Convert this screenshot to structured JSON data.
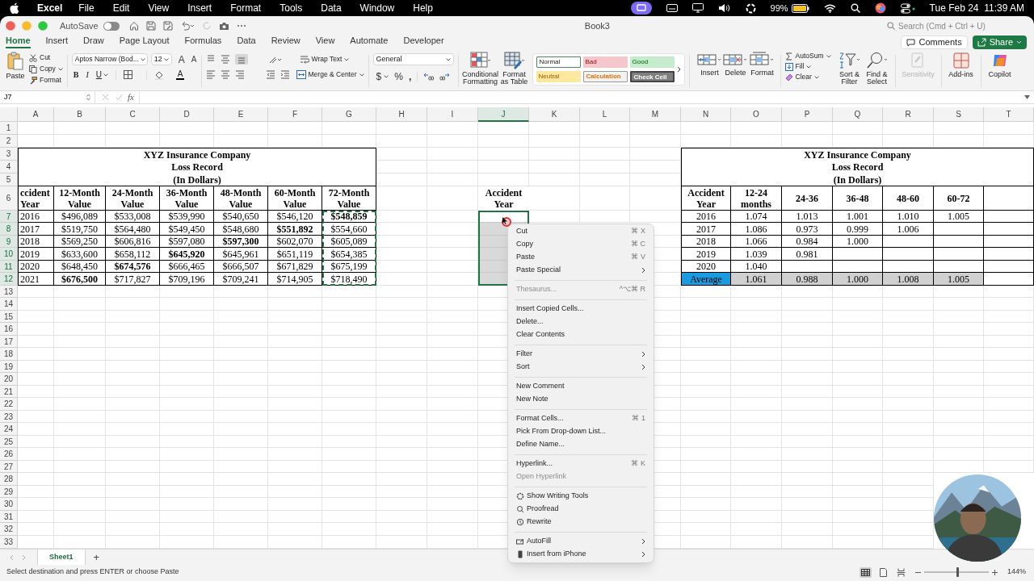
{
  "menubar": {
    "app": "Excel",
    "items": [
      "File",
      "Edit",
      "View",
      "Insert",
      "Format",
      "Tools",
      "Data",
      "Window",
      "Help"
    ],
    "battery": "99%",
    "clock": "Tue Feb 24  11:39 AM"
  },
  "title_bar": {
    "autosave_label": "AutoSave",
    "autosave_on": false,
    "title": "Book3",
    "search_placeholder": "Search (Cmd + Ctrl + U)"
  },
  "tabs": [
    {
      "label": "Home",
      "selected": true
    },
    {
      "label": "Insert",
      "selected": false
    },
    {
      "label": "Draw",
      "selected": false
    },
    {
      "label": "Page Layout",
      "selected": false
    },
    {
      "label": "Formulas",
      "selected": false
    },
    {
      "label": "Data",
      "selected": false
    },
    {
      "label": "Review",
      "selected": false
    },
    {
      "label": "View",
      "selected": false
    },
    {
      "label": "Automate",
      "selected": false
    },
    {
      "label": "Developer",
      "selected": false
    }
  ],
  "comments_button": "Comments",
  "share_button": "Share",
  "ribbon": {
    "paste": "Paste",
    "cut": "Cut",
    "copy": "Copy",
    "format_painter": "Format",
    "font_name": "Aptos Narrow (Bod...",
    "font_size": "12",
    "grow_font": "A",
    "shrink_font": "A",
    "bold": "B",
    "italic": "I",
    "underline": "U",
    "font_color": "A",
    "wrap_text": "Wrap Text",
    "merge_center": "Merge & Center",
    "number_format": "General",
    "currency": "$",
    "percent": "%",
    "comma": ",",
    "conditional_formatting": "Conditional Formatting",
    "format_as_table": "Format as Table",
    "styles": [
      {
        "label": "Normal",
        "color": "#ffffff"
      },
      {
        "label": "Bad",
        "color": "#f6c6cd"
      },
      {
        "label": "Good",
        "color": "#c7eccd"
      },
      {
        "label": "Neutral",
        "color": "#fde8a0"
      },
      {
        "label": "Calculation",
        "color": "#f2f2f2"
      },
      {
        "label": "Check Cell",
        "color": "#7f7f7f"
      }
    ],
    "insert": "Insert",
    "delete": "Delete",
    "format": "Format",
    "autosum": "AutoSum",
    "fill": "Fill",
    "clear": "Clear",
    "sort_filter": "Sort & Filter",
    "find_select": "Find & Select",
    "sensitivity": {
      "label": "Sensitivity",
      "disabled": true
    },
    "add_ins": "Add-ins",
    "copilot": "Copilot"
  },
  "formula_bar": {
    "name_box": "J7",
    "fx": "fx"
  },
  "column_headers": [
    {
      "label": "A",
      "selected": false
    },
    {
      "label": "B",
      "selected": false
    },
    {
      "label": "C",
      "selected": false
    },
    {
      "label": "D",
      "selected": false
    },
    {
      "label": "E",
      "selected": false
    },
    {
      "label": "F",
      "selected": false
    },
    {
      "label": "G",
      "selected": false
    },
    {
      "label": "H",
      "selected": false
    },
    {
      "label": "I",
      "selected": false
    },
    {
      "label": "J",
      "selected": true
    },
    {
      "label": "K",
      "selected": false
    },
    {
      "label": "L",
      "selected": false
    },
    {
      "label": "M",
      "selected": false
    },
    {
      "label": "N",
      "selected": false
    },
    {
      "label": "O",
      "selected": false
    },
    {
      "label": "P",
      "selected": false
    },
    {
      "label": "Q",
      "selected": false
    },
    {
      "label": "R",
      "selected": false
    },
    {
      "label": "S",
      "selected": false
    },
    {
      "label": "T",
      "selected": false
    }
  ],
  "row_headers": [
    {
      "label": "1",
      "selected": false
    },
    {
      "label": "2",
      "selected": false
    },
    {
      "label": "3",
      "selected": false
    },
    {
      "label": "4",
      "selected": false
    },
    {
      "label": "5",
      "selected": false
    },
    {
      "label": "6",
      "selected": false
    },
    {
      "label": "7",
      "selected": true
    },
    {
      "label": "8",
      "selected": true
    },
    {
      "label": "9",
      "selected": true
    },
    {
      "label": "10",
      "selected": true
    },
    {
      "label": "11",
      "selected": true
    },
    {
      "label": "12",
      "selected": true
    },
    {
      "label": "13",
      "selected": false
    },
    {
      "label": "14",
      "selected": false
    },
    {
      "label": "15",
      "selected": false
    },
    {
      "label": "16",
      "selected": false
    },
    {
      "label": "17",
      "selected": false
    },
    {
      "label": "18",
      "selected": false
    },
    {
      "label": "19",
      "selected": false
    },
    {
      "label": "20",
      "selected": false
    },
    {
      "label": "21",
      "selected": false
    },
    {
      "label": "22",
      "selected": false
    },
    {
      "label": "23",
      "selected": false
    },
    {
      "label": "24",
      "selected": false
    },
    {
      "label": "25",
      "selected": false
    },
    {
      "label": "26",
      "selected": false
    },
    {
      "label": "27",
      "selected": false
    },
    {
      "label": "28",
      "selected": false
    },
    {
      "label": "29",
      "selected": false
    },
    {
      "label": "30",
      "selected": false
    },
    {
      "label": "31",
      "selected": false
    },
    {
      "label": "32",
      "selected": false
    },
    {
      "label": "33",
      "selected": false
    }
  ],
  "left_table": {
    "title_lines": [
      "XYZ Insurance Company",
      "Loss Record",
      "(In Dollars)"
    ],
    "columns": [
      {
        "label": "ccident Year",
        "copied": false
      },
      {
        "label": "12-Month Value",
        "copied": false
      },
      {
        "label": "24-Month Value",
        "copied": false
      },
      {
        "label": "36-Month Value",
        "copied": false
      },
      {
        "label": "48-Month Value",
        "copied": false
      },
      {
        "label": "60-Month Value",
        "copied": false
      },
      {
        "label": "72-Month Value",
        "copied": true
      }
    ],
    "rows": [
      [
        {
          "text": "2016",
          "bold": false
        },
        {
          "text": "$496,089",
          "bold": false
        },
        {
          "text": "$533,008",
          "bold": false
        },
        {
          "text": "$539,990",
          "bold": false
        },
        {
          "text": "$540,650",
          "bold": false
        },
        {
          "text": "$546,120",
          "bold": false
        },
        {
          "text": "$548,859",
          "bold": true
        }
      ],
      [
        {
          "text": "2017",
          "bold": false
        },
        {
          "text": "$519,750",
          "bold": false
        },
        {
          "text": "$564,480",
          "bold": false
        },
        {
          "text": "$549,450",
          "bold": false
        },
        {
          "text": "$548,680",
          "bold": false
        },
        {
          "text": "$551,892",
          "bold": true
        },
        {
          "text": "$554,660",
          "bold": false
        }
      ],
      [
        {
          "text": "2018",
          "bold": false
        },
        {
          "text": "$569,250",
          "bold": false
        },
        {
          "text": "$606,816",
          "bold": false
        },
        {
          "text": "$597,080",
          "bold": false
        },
        {
          "text": "$597,300",
          "bold": true
        },
        {
          "text": "$602,070",
          "bold": false
        },
        {
          "text": "$605,089",
          "bold": false
        }
      ],
      [
        {
          "text": "2019",
          "bold": false
        },
        {
          "text": "$633,600",
          "bold": false
        },
        {
          "text": "$658,112",
          "bold": false
        },
        {
          "text": "$645,920",
          "bold": true
        },
        {
          "text": "$645,961",
          "bold": false
        },
        {
          "text": "$651,119",
          "bold": false
        },
        {
          "text": "$654,385",
          "bold": false
        }
      ],
      [
        {
          "text": "2020",
          "bold": false
        },
        {
          "text": "$648,450",
          "bold": false
        },
        {
          "text": "$674,576",
          "bold": true
        },
        {
          "text": "$666,465",
          "bold": false
        },
        {
          "text": "$666,507",
          "bold": false
        },
        {
          "text": "$671,829",
          "bold": false
        },
        {
          "text": "$675,199",
          "bold": false
        }
      ],
      [
        {
          "text": "2021",
          "bold": false
        },
        {
          "text": "$676,500",
          "bold": true
        },
        {
          "text": "$717,827",
          "bold": false
        },
        {
          "text": "$709,196",
          "bold": false
        },
        {
          "text": "$709,241",
          "bold": false
        },
        {
          "text": "$714,905",
          "bold": false
        },
        {
          "text": "$718,490",
          "bold": false
        }
      ]
    ]
  },
  "j_column": {
    "header": "Accident Year",
    "cells": [
      {
        "selected": true,
        "active": true
      },
      {
        "selected": true,
        "active": false
      },
      {
        "selected": true,
        "active": false
      },
      {
        "selected": true,
        "active": false
      },
      {
        "selected": true,
        "active": false
      },
      {
        "selected": true,
        "active": false
      }
    ]
  },
  "right_table": {
    "title_lines": [
      "XYZ Insurance Company",
      "Loss Record",
      "(In Dollars)"
    ],
    "columns": [
      "Accident Year",
      "12-24 months",
      "24-36",
      "36-48",
      "48-60",
      "60-72"
    ],
    "rows": [
      {
        "kind": "data",
        "year": "2016",
        "factors": [
          "1.074",
          "1.013",
          "1.001",
          "1.010",
          "1.005"
        ]
      },
      {
        "kind": "data",
        "year": "2017",
        "factors": [
          "1.086",
          "0.973",
          "0.999",
          "1.006"
        ]
      },
      {
        "kind": "data",
        "year": "2018",
        "factors": [
          "1.066",
          "0.984",
          "1.000"
        ]
      },
      {
        "kind": "data",
        "year": "2019",
        "factors": [
          "1.039",
          "0.981"
        ]
      },
      {
        "kind": "data",
        "year": "2020",
        "factors": [
          "1.040"
        ]
      },
      {
        "kind": "average",
        "year": "Average",
        "factors": [
          "1.061",
          "0.988",
          "1.000",
          "1.008",
          "1.005"
        ]
      }
    ]
  },
  "context_menu": {
    "sections": [
      [
        {
          "label": "Cut",
          "shortcut": "⌘ X",
          "submenu": false,
          "disabled": false
        },
        {
          "label": "Copy",
          "shortcut": "⌘ C",
          "submenu": false,
          "disabled": false
        },
        {
          "label": "Paste",
          "shortcut": "⌘ V",
          "submenu": false,
          "disabled": false
        },
        {
          "label": "Paste Special",
          "submenu": true,
          "disabled": false
        }
      ],
      [
        {
          "label": "Thesaurus...",
          "shortcut": "^⌥⌘ R",
          "submenu": false,
          "disabled": true
        }
      ],
      [
        {
          "label": "Insert Copied Cells...",
          "submenu": false,
          "disabled": false
        },
        {
          "label": "Delete...",
          "submenu": false,
          "disabled": false
        },
        {
          "label": "Clear Contents",
          "submenu": false,
          "disabled": false
        }
      ],
      [
        {
          "label": "Filter",
          "submenu": true,
          "disabled": false
        },
        {
          "label": "Sort",
          "submenu": true,
          "disabled": false
        }
      ],
      [
        {
          "label": "New Comment",
          "submenu": false,
          "disabled": false
        },
        {
          "label": "New Note",
          "submenu": false,
          "disabled": false
        }
      ],
      [
        {
          "label": "Format Cells...",
          "shortcut": "⌘ 1",
          "submenu": false,
          "disabled": false
        },
        {
          "label": "Pick From Drop-down List...",
          "submenu": false,
          "disabled": false
        },
        {
          "label": "Define Name...",
          "submenu": false,
          "disabled": false
        }
      ],
      [
        {
          "label": "Hyperlink...",
          "shortcut": "⌘ K",
          "submenu": false,
          "disabled": false
        },
        {
          "label": "Open Hyperlink",
          "submenu": false,
          "disabled": true
        }
      ],
      [
        {
          "label": "Show Writing Tools",
          "kind": "tool",
          "submenu": false,
          "disabled": false
        },
        {
          "label": "Proofread",
          "kind": "tool",
          "submenu": false,
          "disabled": false
        },
        {
          "label": "Rewrite",
          "kind": "tool",
          "submenu": false,
          "disabled": false
        }
      ],
      [
        {
          "label": "AutoFill",
          "kind": "tool",
          "submenu": true,
          "disabled": false
        },
        {
          "label": "Insert from iPhone",
          "kind": "tool",
          "submenu": true,
          "disabled": false
        }
      ]
    ]
  },
  "sheet_tabs": [
    {
      "label": "Sheet1",
      "selected": true
    }
  ],
  "add_sheet": "+",
  "status_bar": {
    "message": "Select destination and press ENTER or choose Paste",
    "zoom": {
      "level": 0.52,
      "reading": "144%"
    }
  }
}
